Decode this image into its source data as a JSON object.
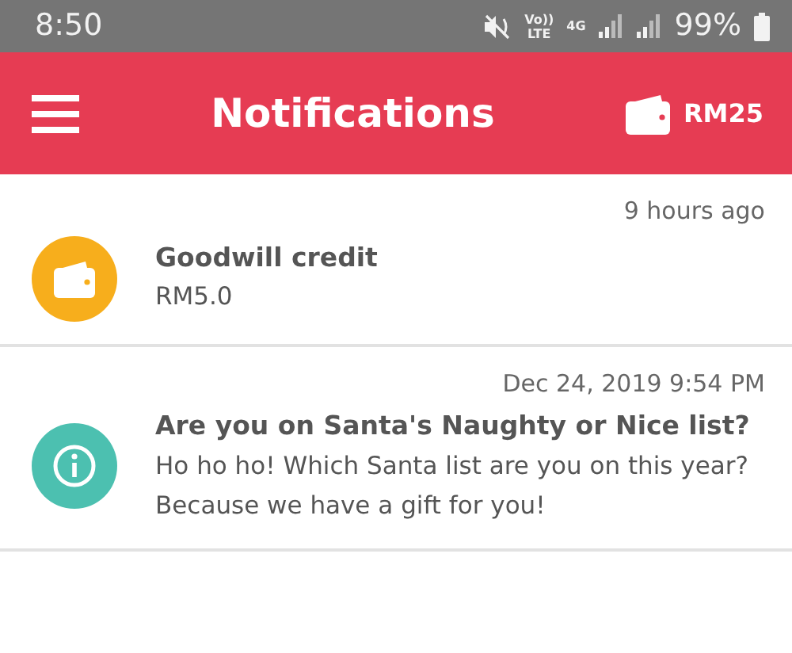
{
  "status_bar": {
    "time": "8:50",
    "volte_top": "Vo))",
    "volte_bottom": "LTE",
    "network": "4G",
    "battery": "99%"
  },
  "header": {
    "title": "Notifications",
    "balance": "RM25"
  },
  "notifications": [
    {
      "kind": "wallet",
      "color": "#f7ae1c",
      "time": "9 hours ago",
      "title": "Goodwill credit",
      "body": "RM5.0"
    },
    {
      "kind": "info",
      "color": "#4cc0b0",
      "time": "Dec 24, 2019 9:54 PM",
      "title": "Are you on Santa's Naughty or Nice list?",
      "body": "Ho ho ho! Which Santa list are you on this year? Because we have a gift for you!"
    }
  ]
}
